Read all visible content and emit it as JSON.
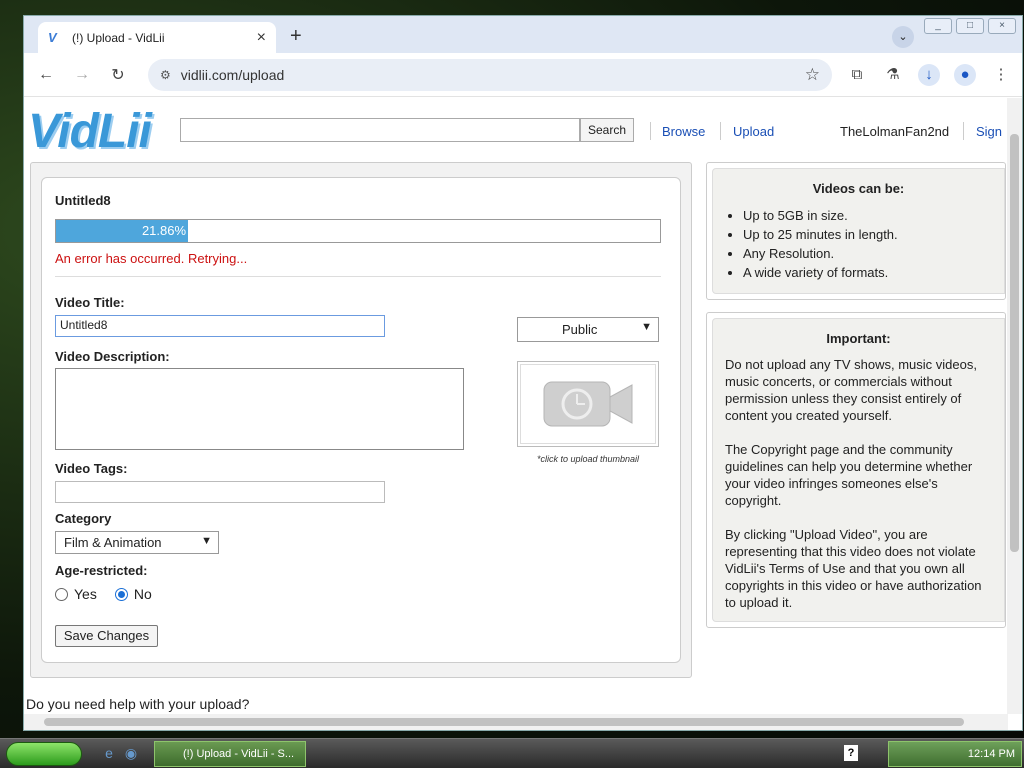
{
  "browser": {
    "tab_title": "(!) Upload - VidLii",
    "url": "vidlii.com/upload"
  },
  "header": {
    "logo": "VidLii",
    "search_button": "Search",
    "nav_browse": "Browse",
    "nav_upload": "Upload",
    "username": "TheLolmanFan2nd",
    "sign_link": "Sign"
  },
  "upload": {
    "file_title": "Untitled8",
    "progress_label": "21.86%",
    "progress_fraction": 0.2186,
    "error": "An error has occurred. Retrying...",
    "video_title_label": "Video Title:",
    "video_title_value": "Untitled8",
    "privacy": "Public",
    "description_label": "Video Description:",
    "thumbnail_caption": "*click to upload thumbnail",
    "tags_label": "Video Tags:",
    "category_label": "Category",
    "category_value": "Film & Animation",
    "age_label": "Age-restricted:",
    "age_yes": "Yes",
    "age_no": "No",
    "save_button": "Save Changes"
  },
  "sidebar": {
    "videos_heading": "Videos can be:",
    "videos_items": [
      "Up to 5GB in size.",
      "Up to 25 minutes in length.",
      "Any Resolution.",
      "A wide variety of formats."
    ],
    "important_heading": "Important:",
    "important_p1": "Do not upload any TV shows, music videos, music concerts, or commercials without permission unless they consist entirely of content you created yourself.",
    "important_p2": "The Copyright page and the community guidelines can help you determine whether your video infringes someones else's copyright.",
    "important_p3": "By clicking \"Upload Video\", you are representing that this video does not violate VidLii's Terms of Use and that you own all copyrights in this video or have authorization to upload it."
  },
  "footer": {
    "help": "Do you need help with your upload?"
  },
  "taskbar": {
    "task_title": "(!) Upload - VidLii - S...",
    "clock": "12:14 PM"
  },
  "colors": {
    "accent": "#4ea6dc",
    "link": "#1a4fb5",
    "error": "#cc1111"
  }
}
